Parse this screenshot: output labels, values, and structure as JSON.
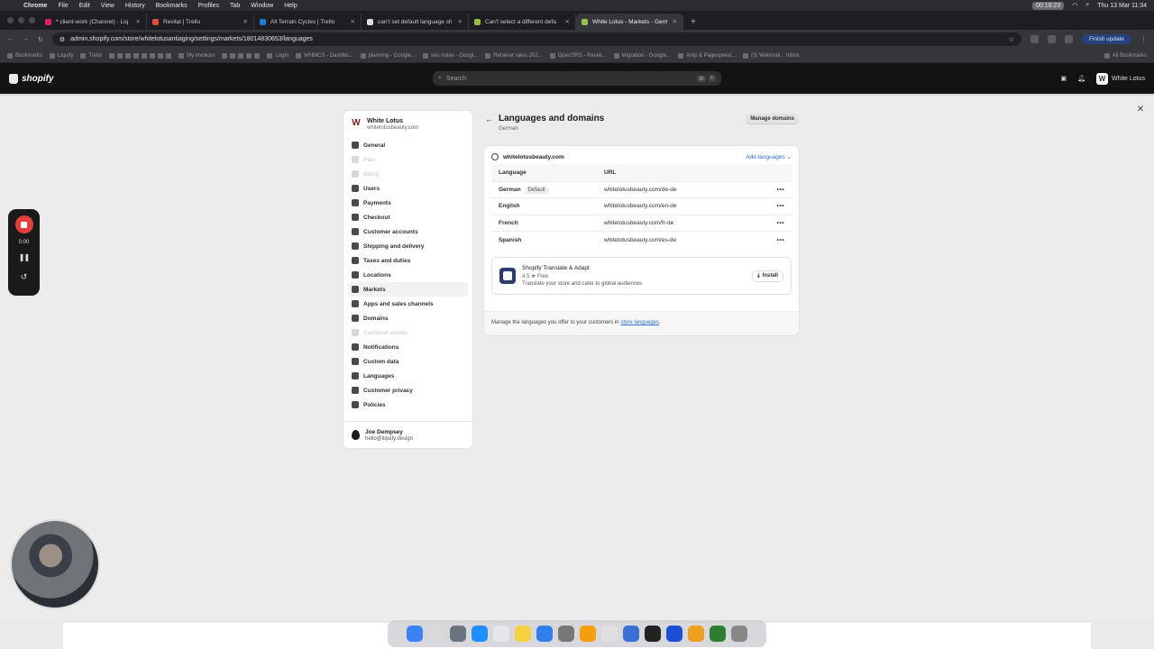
{
  "menubar": {
    "app": "Chrome",
    "menus": [
      "File",
      "Edit",
      "View",
      "History",
      "Bookmarks",
      "Profiles",
      "Tab",
      "Window",
      "Help"
    ],
    "recording_time": "00:18:23",
    "datetime": "Thu 13 Mar  11:34"
  },
  "tabs": [
    {
      "title": "* client-work (Channel) - Liq",
      "color": "#e01e5a"
    },
    {
      "title": "Revital | Trello",
      "color": "#e24b3b"
    },
    {
      "title": "All Terrain Cycles | Trello",
      "color": "#1d7bd8"
    },
    {
      "title": "can't set default language sh",
      "color": "#dddddd"
    },
    {
      "title": "Can't select a different defa",
      "color": "#95bf47"
    },
    {
      "title": "White Lotus - Markets - Germ",
      "color": "#95bf47"
    }
  ],
  "address": {
    "url": "admin.shopify.com/store/whitelotusantiaging/settings/markets/18014830653/languages",
    "finish_update": "Finish update"
  },
  "bookmarks": {
    "items": [
      "Bookmarks",
      "Liquify",
      "Trello",
      "My invoices",
      "Login",
      "WHMCS - Dashbo...",
      "planning - Google...",
      "seo notes - Googl...",
      "Retainer rates 202...",
      "OpenSRS - Reseli...",
      "Migration - Google...",
      "Amp & Pagespeed...",
      "(3) Webmail :: Inbox"
    ],
    "all": "All Bookmarks"
  },
  "shopify": {
    "logo": "shopify",
    "search_placeholder": "Search",
    "kbd": [
      "⌘",
      "K"
    ],
    "store_name": "White Lotus",
    "store_initial": "W"
  },
  "nav": {
    "store_name": "White Lotus",
    "store_url": "whitelotusbeauty.com",
    "items": [
      {
        "label": "General",
        "state": "normal"
      },
      {
        "label": "Plan",
        "state": "disabled"
      },
      {
        "label": "Billing",
        "state": "disabled"
      },
      {
        "label": "Users",
        "state": "normal"
      },
      {
        "label": "Payments",
        "state": "normal"
      },
      {
        "label": "Checkout",
        "state": "normal"
      },
      {
        "label": "Customer accounts",
        "state": "normal"
      },
      {
        "label": "Shipping and delivery",
        "state": "normal"
      },
      {
        "label": "Taxes and duties",
        "state": "normal"
      },
      {
        "label": "Locations",
        "state": "normal"
      },
      {
        "label": "Markets",
        "state": "active"
      },
      {
        "label": "Apps and sales channels",
        "state": "normal"
      },
      {
        "label": "Domains",
        "state": "normal"
      },
      {
        "label": "Customer events",
        "state": "disabled"
      },
      {
        "label": "Notifications",
        "state": "normal"
      },
      {
        "label": "Custom data",
        "state": "normal"
      },
      {
        "label": "Languages",
        "state": "normal"
      },
      {
        "label": "Customer privacy",
        "state": "normal"
      },
      {
        "label": "Policies",
        "state": "normal"
      }
    ],
    "user_name": "Joe Dempsey",
    "user_email": "hello@liquify.design"
  },
  "page": {
    "title": "Languages and domains",
    "subtitle": "German",
    "manage_domains": "Manage domains"
  },
  "card": {
    "domain": "whitelotusbeauty.com",
    "add_languages": "Add languages",
    "columns": [
      "Language",
      "URL"
    ],
    "rows": [
      {
        "language": "German",
        "badge": "Default",
        "url": "whitelotusbeauty.com/de-de"
      },
      {
        "language": "English",
        "badge": "",
        "url": "whitelotusbeauty.com/en-de"
      },
      {
        "language": "French",
        "badge": "",
        "url": "whitelotusbeauty.com/fr-de"
      },
      {
        "language": "Spanish",
        "badge": "",
        "url": "whitelotusbeauty.com/es-de"
      }
    ],
    "app": {
      "name": "Shopify Translate & Adapt",
      "rating": "4.5",
      "price": "Free",
      "description": "Translate your store and cater to global audiences",
      "install": "Install"
    },
    "footer_text": "Manage the languages you offer to your customers in ",
    "footer_link": "store languages",
    "footer_end": "."
  },
  "recorder": {
    "time": "0:00"
  }
}
